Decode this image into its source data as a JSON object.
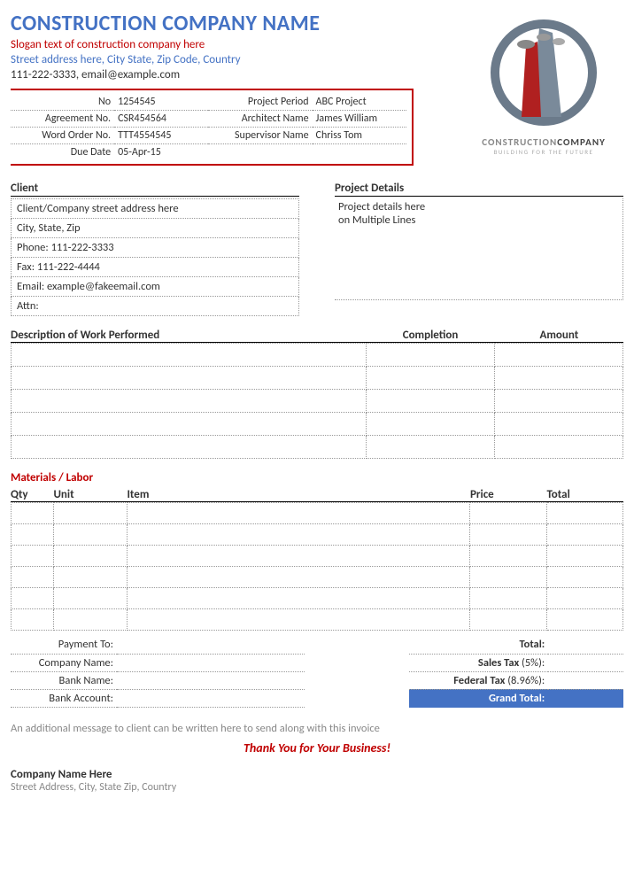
{
  "header": {
    "company_name": "CONSTRUCTION COMPANY NAME",
    "slogan": "Slogan text of construction company here",
    "address": "Street address here, City State, Zip Code, Country",
    "contact": "111-222-3333, email@example.com",
    "logo_line1a": "CONSTRUCTION",
    "logo_line1b": "COMPANY",
    "logo_line2": "BUILDING FOR THE FUTURE"
  },
  "meta": {
    "no_label": "No",
    "no_val": "1254545",
    "period_label": "Project Period",
    "period_val": "ABC Project",
    "agree_label": "Agreement No.",
    "agree_val": "CSR454564",
    "arch_label": "Architect Name",
    "arch_val": "James William",
    "wo_label": "Word Order No.",
    "wo_val": "TTT4554545",
    "sup_label": "Supervisor Name",
    "sup_val": "Chriss Tom",
    "due_label": "Due Date",
    "due_val": "05-Apr-15"
  },
  "client": {
    "title": "Client",
    "addr": "Client/Company street address here",
    "csz": "City, State, Zip",
    "phone": "Phone: 111-222-3333",
    "fax": "Fax: 111-222-4444",
    "email": "Email: example@fakeemail.com",
    "attn": "Attn:"
  },
  "project": {
    "title": "Project Details",
    "line1": "Project details here",
    "line2": "on Multiple Lines"
  },
  "work": {
    "h1": "Description of Work Performed",
    "h2": "Completion",
    "h3": "Amount"
  },
  "materials": {
    "title": "Materials / Labor",
    "qty": "Qty",
    "unit": "Unit",
    "item": "Item",
    "price": "Price",
    "total": "Total"
  },
  "payment": {
    "to": "Payment To:",
    "company": "Company Name:",
    "bank": "Bank Name:",
    "acct": "Bank Account:"
  },
  "totals": {
    "total": "Total:",
    "sales_a": "Sales Tax",
    "sales_b": " (5%):",
    "fed_a": "Federal Tax",
    "fed_b": " (8.96%):",
    "grand": "Grand Total:"
  },
  "footer": {
    "msg": "An additional message to client can be written here to send along with this invoice",
    "thanks": "Thank You for Your Business!",
    "company": "Company Name Here",
    "addr": "Street Address, City, State Zip, Country"
  }
}
